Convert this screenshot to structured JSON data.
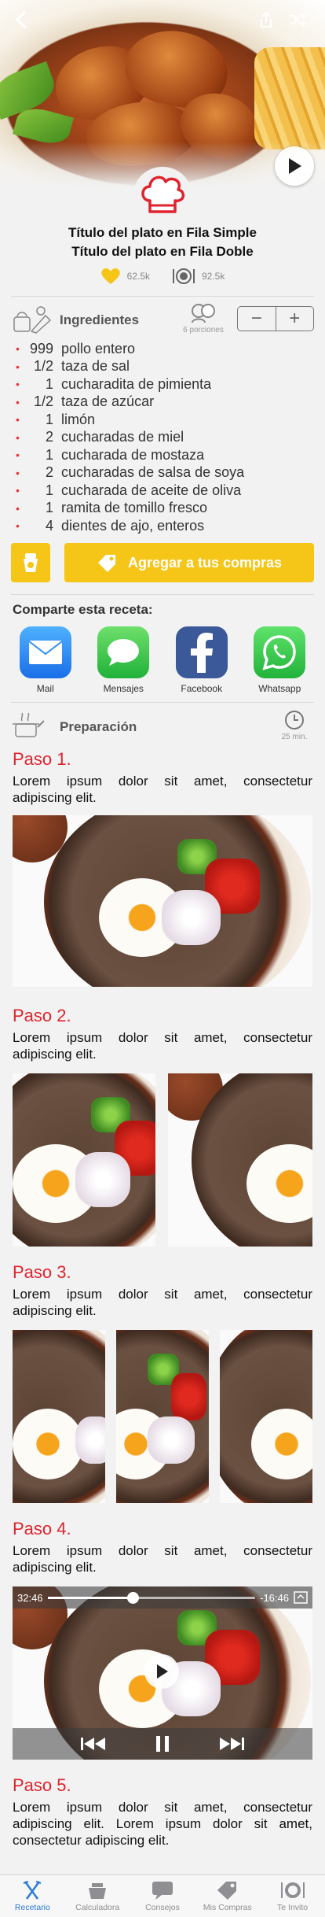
{
  "header": {
    "back_icon": "chevron-left-icon",
    "share_icon": "share-icon",
    "shuffle_icon": "shuffle-icon"
  },
  "recipe": {
    "title_line1": "Título del plato en Fila Simple",
    "title_line2": "Título del plato en Fila Doble",
    "likes": "62.5k",
    "servings_count": "92.5k"
  },
  "ingredients": {
    "title": "Ingredientes",
    "portions": "6 porciones",
    "minus": "−",
    "plus": "+",
    "items": [
      {
        "qty": "999",
        "text": "pollo entero"
      },
      {
        "qty": "1/2",
        "text": "taza de sal"
      },
      {
        "qty": "1",
        "text": "cucharadita de pimienta"
      },
      {
        "qty": "1/2",
        "text": "taza de azúcar"
      },
      {
        "qty": "1",
        "text": "limón"
      },
      {
        "qty": "2",
        "text": "cucharadas de miel"
      },
      {
        "qty": "1",
        "text": "cucharada de mostaza"
      },
      {
        "qty": "2",
        "text": "cucharadas de salsa de soya"
      },
      {
        "qty": "1",
        "text": "cucharada de aceite de oliva"
      },
      {
        "qty": "1",
        "text": "ramita de tomillo fresco"
      },
      {
        "qty": "4",
        "text": "dientes de ajo, enteros"
      }
    ],
    "cart_button": "Agregar a tus compras"
  },
  "share": {
    "title": "Comparte esta receta:",
    "items": [
      {
        "label": "Mail",
        "icon": "mail-icon",
        "color": "#2f8ef2"
      },
      {
        "label": "Mensajes",
        "icon": "messages-icon",
        "color": "#37c94c"
      },
      {
        "label": "Facebook",
        "icon": "facebook-icon",
        "color": "#3b5998"
      },
      {
        "label": "Whatsapp",
        "icon": "whatsapp-icon",
        "color": "#31c240"
      }
    ]
  },
  "preparation": {
    "title": "Preparación",
    "time": "25 min.",
    "steps": [
      {
        "label": "Paso 1.",
        "text": "Lorem ipsum dolor sit amet, consectetur adipiscing elit."
      },
      {
        "label": "Paso 2.",
        "text": "Lorem ipsum dolor sit amet, consectetur adipiscing elit."
      },
      {
        "label": "Paso 3.",
        "text": "Lorem ipsum dolor sit amet, consectetur adipiscing elit."
      },
      {
        "label": "Paso 4.",
        "text": "Lorem ipsum dolor sit amet, consectetur adipiscing elit."
      },
      {
        "label": "Paso 5.",
        "text": "Lorem ipsum dolor sit amet, consectetur adipiscing elit. Lorem ipsum dolor sit amet, consectetur adipiscing elit."
      }
    ],
    "video": {
      "elapsed": "32:46",
      "remaining": "-16:46",
      "progress": 0.41
    }
  },
  "tabbar": {
    "items": [
      {
        "label": "Recetario",
        "icon": "fork-knife-icon",
        "active": true
      },
      {
        "label": "Calculadora",
        "icon": "scale-icon",
        "active": false
      },
      {
        "label": "Consejos",
        "icon": "chat-icon",
        "active": false
      },
      {
        "label": "Mis Compras",
        "icon": "tags-icon",
        "active": false
      },
      {
        "label": "Te Invito",
        "icon": "plate-icon",
        "active": false
      }
    ]
  },
  "colors": {
    "accent": "#f5c518",
    "step_label": "#e0232d",
    "active_tab": "#2a7bd6"
  }
}
